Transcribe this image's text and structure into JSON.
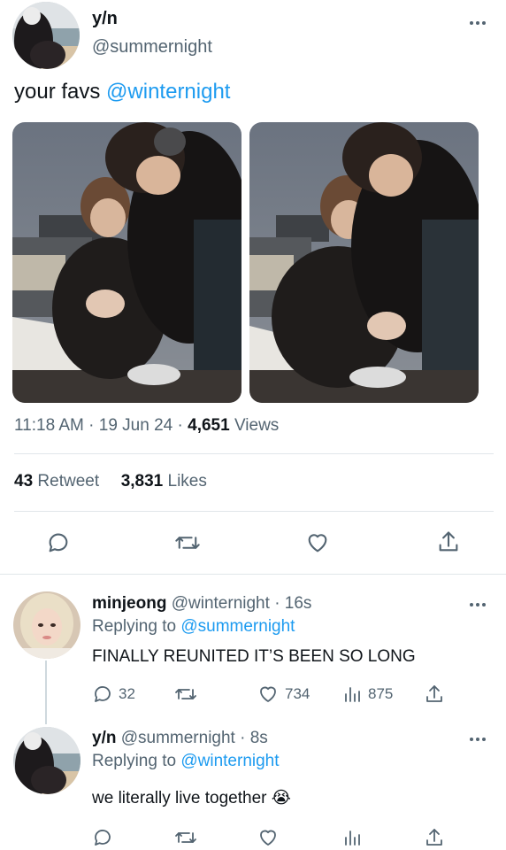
{
  "tweet": {
    "author_name": "y/n",
    "author_handle": "@summernight",
    "text_prefix": "your favs ",
    "text_mention": "@winternight",
    "time": "11:18 AM",
    "date": "19 Jun 24",
    "views_count": "4,651",
    "views_label": "Views",
    "retweets_count": "43",
    "retweets_label": "Retweet",
    "likes_count": "3,831",
    "likes_label": "Likes"
  },
  "replies": [
    {
      "name": "minjeong",
      "handle": "@winternight",
      "age": "16s",
      "replying_label": "Replying to",
      "replying_to": "@summernight",
      "text": "FINALLY REUNITED IT’S BEEN SO LONG",
      "replies_count": "32",
      "likes_count": "734",
      "views_count": "875"
    },
    {
      "name": "y/n",
      "handle": "@summernight",
      "age": "8s",
      "replying_label": "Replying to",
      "replying_to": "@winternight",
      "text": "we literally live together",
      "emoji": "😭"
    }
  ],
  "colors": {
    "accent": "#1d9bf0",
    "muted": "#536471",
    "text": "#0f1419",
    "divider": "#e1e6ea"
  }
}
